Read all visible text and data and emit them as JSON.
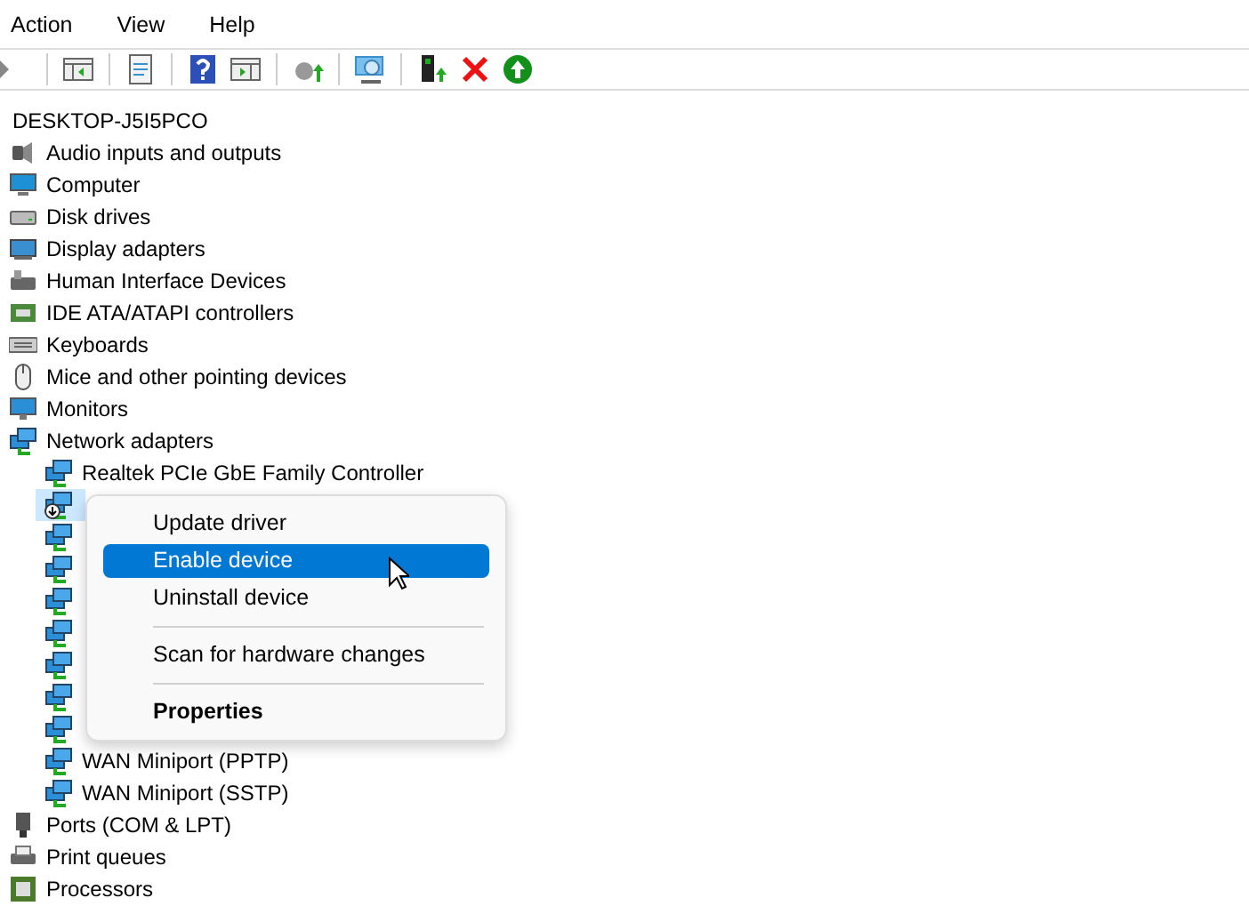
{
  "menu_bar": [
    "Action",
    "View",
    "Help"
  ],
  "tree": {
    "label": "DESKTOP-J5I5PCO",
    "children": [
      {
        "label": "Audio inputs and outputs"
      },
      {
        "label": "Computer"
      },
      {
        "label": "Disk drives"
      },
      {
        "label": "Display adapters"
      },
      {
        "label": "Human Interface Devices"
      },
      {
        "label": "IDE ATA/ATAPI controllers"
      },
      {
        "label": "Keyboards"
      },
      {
        "label": "Mice and other pointing devices"
      },
      {
        "label": "Monitors"
      },
      {
        "label": "Network adapters",
        "children": [
          {
            "label": "Realtek PCIe GbE Family Controller",
            "selected": false,
            "disabled": false
          },
          {
            "selected": true,
            "disabled": true
          },
          {
            "selected": false,
            "disabled": false
          },
          {
            "selected": false,
            "disabled": false
          },
          {
            "selected": false,
            "disabled": false
          },
          {
            "selected": false,
            "disabled": false
          },
          {
            "selected": false,
            "disabled": false
          },
          {
            "selected": false,
            "disabled": false
          },
          {
            "selected": false,
            "disabled": false
          },
          {
            "label": "WAN Miniport (PPTP)",
            "selected": false,
            "disabled": false
          },
          {
            "label": "WAN Miniport (SSTP)",
            "selected": false,
            "disabled": false
          }
        ]
      },
      {
        "label": "Ports (COM & LPT)"
      },
      {
        "label": "Print queues"
      },
      {
        "label": "Processors"
      }
    ]
  },
  "context_menu": [
    {
      "kind": "item",
      "label": "Update driver",
      "selected": false,
      "default": false
    },
    {
      "kind": "item",
      "label": "Enable device",
      "selected": true,
      "default": false
    },
    {
      "kind": "item",
      "label": "Uninstall device",
      "selected": false,
      "default": false
    },
    {
      "kind": "separator"
    },
    {
      "kind": "item",
      "label": "Scan for hardware changes",
      "selected": false,
      "default": false
    },
    {
      "kind": "separator"
    },
    {
      "kind": "item",
      "label": "Properties",
      "selected": false,
      "default": true
    }
  ]
}
